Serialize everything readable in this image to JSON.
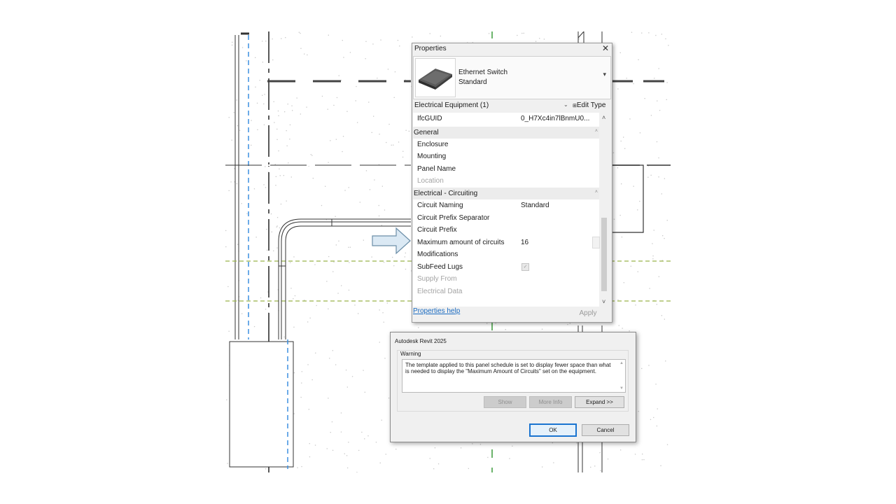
{
  "properties": {
    "title": "Properties",
    "close_glyph": "✕",
    "type_name": "Ethernet Switch",
    "type_subname": "Standard",
    "dropdown_glyph": "▾",
    "category": "Electrical Equipment (1)",
    "edit_type": "Edit Type",
    "edit_type_icon": "edit-type-icon",
    "rows": [
      {
        "label": "IfcGUID",
        "value": "0_H7Xc4in7lBnmU0..."
      },
      {
        "label": "General",
        "value": ""
      },
      {
        "label": "Enclosure",
        "value": ""
      },
      {
        "label": "Mounting",
        "value": ""
      },
      {
        "label": "Panel Name",
        "value": ""
      },
      {
        "label": "Location",
        "value": ""
      },
      {
        "label": "Electrical - Circuiting",
        "value": ""
      },
      {
        "label": "Circuit Naming",
        "value": "Standard"
      },
      {
        "label": "Circuit Prefix Separator",
        "value": ""
      },
      {
        "label": "Circuit Prefix",
        "value": ""
      },
      {
        "label": "Maximum amount of circuits",
        "value": "16"
      },
      {
        "label": "Modifications",
        "value": ""
      },
      {
        "label": "SubFeed Lugs",
        "value": ""
      },
      {
        "label": "Supply From",
        "value": ""
      },
      {
        "label": "Electrical Data",
        "value": ""
      }
    ],
    "subfeed_lugs_checked": true,
    "help_link": "Properties help",
    "apply_label": "Apply"
  },
  "dialog": {
    "title": "Autodesk Revit 2025",
    "group_label": "Warning",
    "message": "The template applied to this panel schedule is set to display fewer space than what is needed to display the \"Maximum Amount of Circuits\" set on the equipment.",
    "show_label": "Show",
    "more_info_label": "More Info",
    "expand_label": "Expand >>",
    "ok_label": "OK",
    "cancel_label": "Cancel"
  },
  "colors": {
    "accent_blue": "#1a74d0",
    "dashed_green": "#9bb54a",
    "dashed_blue": "#3b8fe0",
    "arrow_fill": "#dbe9f4",
    "arrow_stroke": "#6b8ea8"
  }
}
